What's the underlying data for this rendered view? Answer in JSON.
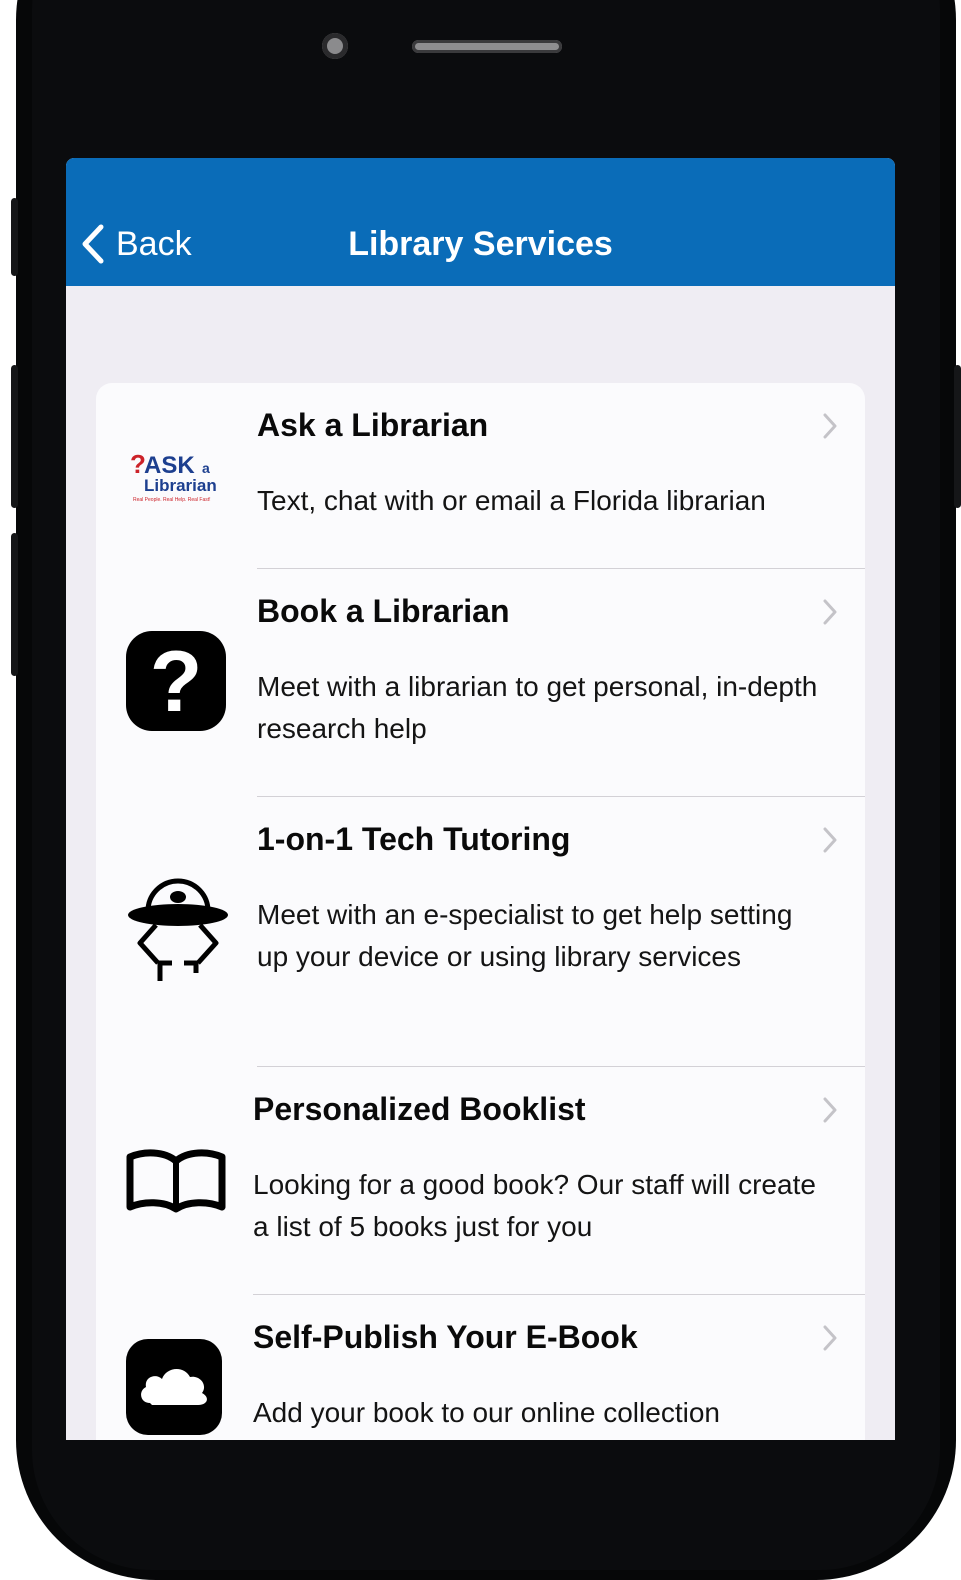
{
  "navbar": {
    "back_label": "Back",
    "title": "Library Services",
    "bg_color": "#0a6cb8"
  },
  "services": [
    {
      "title": "Ask a Librarian",
      "description": "Text, chat with or email a Florida librarian",
      "icon": "ask-a-librarian-logo-icon",
      "logo": {
        "word1": "ASK",
        "word2": "a",
        "word3": "Librarian",
        "tagline": "Real People. Real Help. Real Fast!"
      }
    },
    {
      "title": "Book a Librarian",
      "description": "Meet with a librarian to get personal, in-depth research help",
      "icon": "question-mark-icon"
    },
    {
      "title": "1-on-1 Tech Tutoring",
      "description": "Meet with an e-specialist to get help setting up your device or using library services",
      "icon": "ufo-icon"
    },
    {
      "title": "Personalized Booklist",
      "description": "Looking for a good book? Our staff will create a list of 5 books just for you",
      "icon": "open-book-icon"
    },
    {
      "title": "Self-Publish Your E-Book",
      "description": "Add your book to our online collection",
      "icon": "cloud-icon"
    }
  ]
}
